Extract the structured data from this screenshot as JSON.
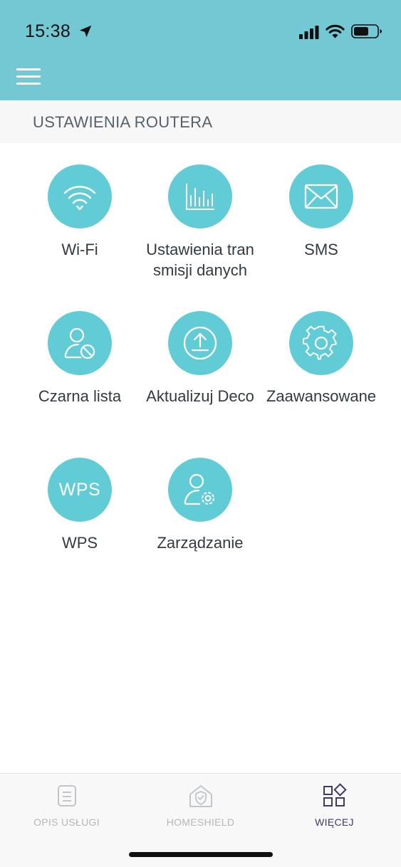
{
  "status_bar": {
    "time": "15:38",
    "icons": [
      "location-arrow-icon",
      "cellular-signal-icon",
      "wifi-icon",
      "battery-icon"
    ]
  },
  "header": {
    "menu_icon": "hamburger-menu-icon",
    "background": "#74c8d3"
  },
  "section": {
    "title": "USTAWIENIA ROUTERA"
  },
  "tiles": [
    {
      "label": "Wi-Fi",
      "icon": "wifi-icon"
    },
    {
      "label": "Ustawienia transmisji danych",
      "icon": "bar-chart-icon"
    },
    {
      "label": "SMS",
      "icon": "envelope-icon"
    },
    {
      "label": "Czarna lista",
      "icon": "user-blocked-icon"
    },
    {
      "label": "Aktualizuj Deco",
      "icon": "upload-icon"
    },
    {
      "label": "Zaawansowane",
      "icon": "gear-icon"
    },
    {
      "label": "WPS",
      "icon_text": "WPS"
    },
    {
      "label": "Zarządzanie",
      "icon": "user-settings-icon"
    }
  ],
  "tab_bar": {
    "tabs": [
      {
        "label": "OPIS USŁUGI",
        "icon": "document-icon",
        "active": false
      },
      {
        "label": "HOMESHIELD",
        "icon": "home-shield-icon",
        "active": false
      },
      {
        "label": "WIĘCEJ",
        "icon": "grid-icon",
        "active": true
      }
    ]
  },
  "colors": {
    "accent": "#74c8d3",
    "tile_circle": "#62ccd6",
    "active_tab": "#3e3a6e",
    "inactive_tab": "#b3b7bb"
  }
}
